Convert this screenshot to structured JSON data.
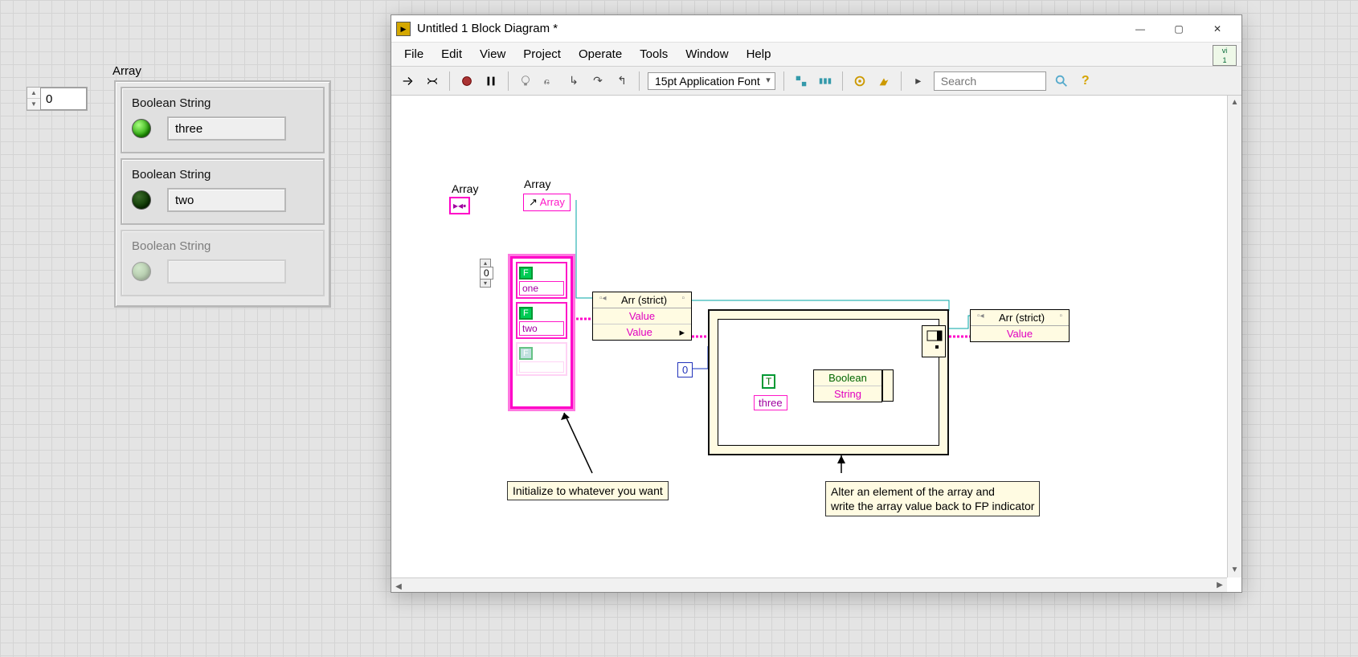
{
  "front_panel": {
    "array_label": "Array",
    "index_value": "0",
    "elements": [
      {
        "title": "Boolean String",
        "led": "on",
        "string": "three"
      },
      {
        "title": "Boolean String",
        "led": "off",
        "string": "two"
      },
      {
        "title": "Boolean String",
        "led": "dim",
        "string": ""
      }
    ]
  },
  "window": {
    "title": "Untitled 1 Block Diagram *",
    "min_label": "—",
    "max_label": "▢",
    "close_label": "✕",
    "menus": [
      "File",
      "Edit",
      "View",
      "Project",
      "Operate",
      "Tools",
      "Window",
      "Help"
    ],
    "font_label": "15pt Application Font",
    "search_placeholder": "Search"
  },
  "diagram": {
    "array_typedef_label": "Array",
    "array_local_label": "Array",
    "array_local_text": "Array",
    "cluster_index": "0",
    "cluster_elems": [
      {
        "bool": "F",
        "str": "one"
      },
      {
        "bool": "F",
        "str": "two"
      },
      {
        "bool": "F",
        "str": ""
      }
    ],
    "prop1": {
      "title": "Arr (strict)",
      "rows": [
        "Value",
        "Value"
      ]
    },
    "replace_index": "0",
    "seq": {
      "bool_const": "T",
      "str_const": "three",
      "bundle_labels": [
        "Boolean",
        "String"
      ]
    },
    "prop2": {
      "title": "Arr (strict)",
      "rows": [
        "Value"
      ]
    },
    "note1": "Initialize to whatever you want",
    "note2_line1": "Alter an element of the array and",
    "note2_line2": "write the array value back to FP indicator"
  }
}
